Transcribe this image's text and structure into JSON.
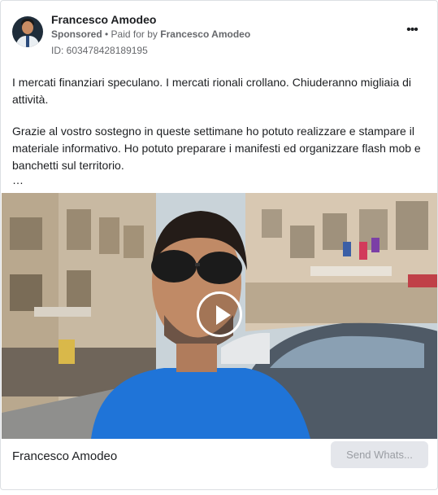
{
  "advertiser": {
    "name": "Francesco Amodeo",
    "sponsored_label": "Sponsored",
    "paid_for_prefix": "• Paid for by",
    "paid_for_name": "Francesco Amodeo",
    "ad_id": "ID: 603478428189195"
  },
  "post": {
    "paragraph1": "I mercati finanziari speculano. I mercati rionali crollano. Chiuderanno migliaia di attività.",
    "paragraph2": "Grazie al vostro sostegno in queste settimane ho potuto realizzare e stampare il materiale informativo. Ho potuto preparare i manifesti ed organizzare flash mob e banchetti sul territorio.",
    "truncation": "…"
  },
  "menu": {
    "more_icon": "more-horizontal-icon",
    "glyph": "•••"
  },
  "video": {
    "play_icon": "play-icon"
  },
  "footer": {
    "title": "Francesco Amodeo",
    "cta_label": "Send Whats..."
  },
  "colors": {
    "text_primary": "#1c1e21",
    "text_secondary": "#65676b",
    "cta_background": "#e4e6eb",
    "cta_text": "#9a9da3",
    "shirt_blue": "#1f74d8"
  }
}
